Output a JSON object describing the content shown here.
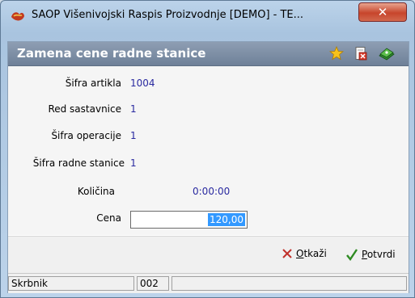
{
  "window": {
    "title": "SAOP  Višenivojski Raspis Proizvodnje [DEMO] - TE...",
    "close_symbol": "✕"
  },
  "dialog": {
    "title": "Zamena cene radne stanice",
    "icons": [
      "star-icon",
      "delete-icon",
      "book-icon"
    ]
  },
  "form": {
    "sifra_artikla": {
      "label": "Šifra artikla",
      "value": "1004"
    },
    "red_sastavnice": {
      "label": "Red sastavnice",
      "value": "1"
    },
    "sifra_operacije": {
      "label": "Šifra operacije",
      "value": "1"
    },
    "sifra_radne_stanice": {
      "label": "Šifra radne stanice",
      "value": "1"
    },
    "kolicina": {
      "label": "Količina",
      "value": "0:00:00"
    },
    "cena": {
      "label": "Cena",
      "value": "120,00"
    }
  },
  "buttons": {
    "cancel": {
      "mnemonic": "O",
      "rest": "tkaži"
    },
    "confirm": {
      "mnemonic": "P",
      "rest": "otvrdi"
    }
  },
  "status": {
    "user": "Skrbnik",
    "code": "002",
    "extra": ""
  },
  "colors": {
    "header_bg": "#7e8fa6",
    "value_text": "#2a2aa0",
    "selection": "#3399ff",
    "cancel_x": "#c0302a",
    "confirm_check": "#2e8b22"
  }
}
